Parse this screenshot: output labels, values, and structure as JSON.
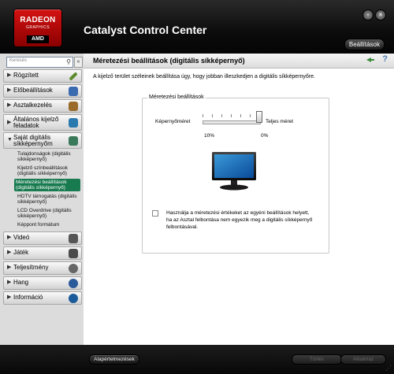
{
  "app": {
    "brand_line1": "RADEON",
    "brand_line2": "GRAPHICS",
    "brand_line3": "AMD",
    "title": "Catalyst Control Center",
    "preferences_label": "Beállítások",
    "minimize_glyph": "-",
    "close_glyph": "×"
  },
  "sidebar": {
    "search_placeholder": "Keresés",
    "search_icon_glyph": "⚲",
    "collapse_glyph": "«",
    "items": [
      {
        "label": "Rögzített",
        "icon_color": "#5a8a2a"
      },
      {
        "label": "Előbeállítások",
        "icon_color": "#3a6ab0"
      },
      {
        "label": "Asztalkezelés",
        "icon_color": "#9a6a2a"
      },
      {
        "label": "Általános kijelző feladatok",
        "icon_color": "#2a7ab0"
      },
      {
        "label": "Saját digitális síkképernyőm",
        "icon_color": "#3a7a5a"
      }
    ],
    "subitems": [
      "Tulajdonságok (digitális síkképernyő)",
      "Kijelző színbeállítások (digitális síkképernyő)",
      "Méretezési beállítások (digitális síkképernyő)",
      "HDTV támogatás (digitális síkképernyő)",
      "LCD Overdrive (digitális síkképernyő)",
      "Képpont formátum"
    ],
    "items_bottom": [
      {
        "label": "Videó",
        "icon_color": "#555555"
      },
      {
        "label": "Játék",
        "icon_color": "#4a4a4a"
      },
      {
        "label": "Teljesítmény",
        "icon_color": "#666666"
      },
      {
        "label": "Hang",
        "icon_color": "#2a5a9a"
      },
      {
        "label": "Információ",
        "icon_color": "#1a5a9a"
      }
    ]
  },
  "main": {
    "title": "Méretezési beállítások (digitális síkképernyő)",
    "help_glyph": "?",
    "description": "A kijelző terület széleinek beállítása úgy, hogy jobban illeszkedjen a digitális síkképernyőre.",
    "group_title": "Méretezési beállítások",
    "slider": {
      "left_label": "Képernyőméret",
      "right_label": "Teljes méret",
      "left_value": "10%",
      "right_value": "0%",
      "value_fraction": 1.0
    },
    "checkbox_text": "Használja a méretezési értékeket az egyéni beállítások helyett, ha az Asztal felbontása nem egyezik meg a digitális síkképernyő felbontásával."
  },
  "footer": {
    "defaults_label": "Alapértelmezések",
    "discard_label": "Törlés",
    "apply_label": "Alkalmaz",
    "grip_glyph": "⋰"
  }
}
